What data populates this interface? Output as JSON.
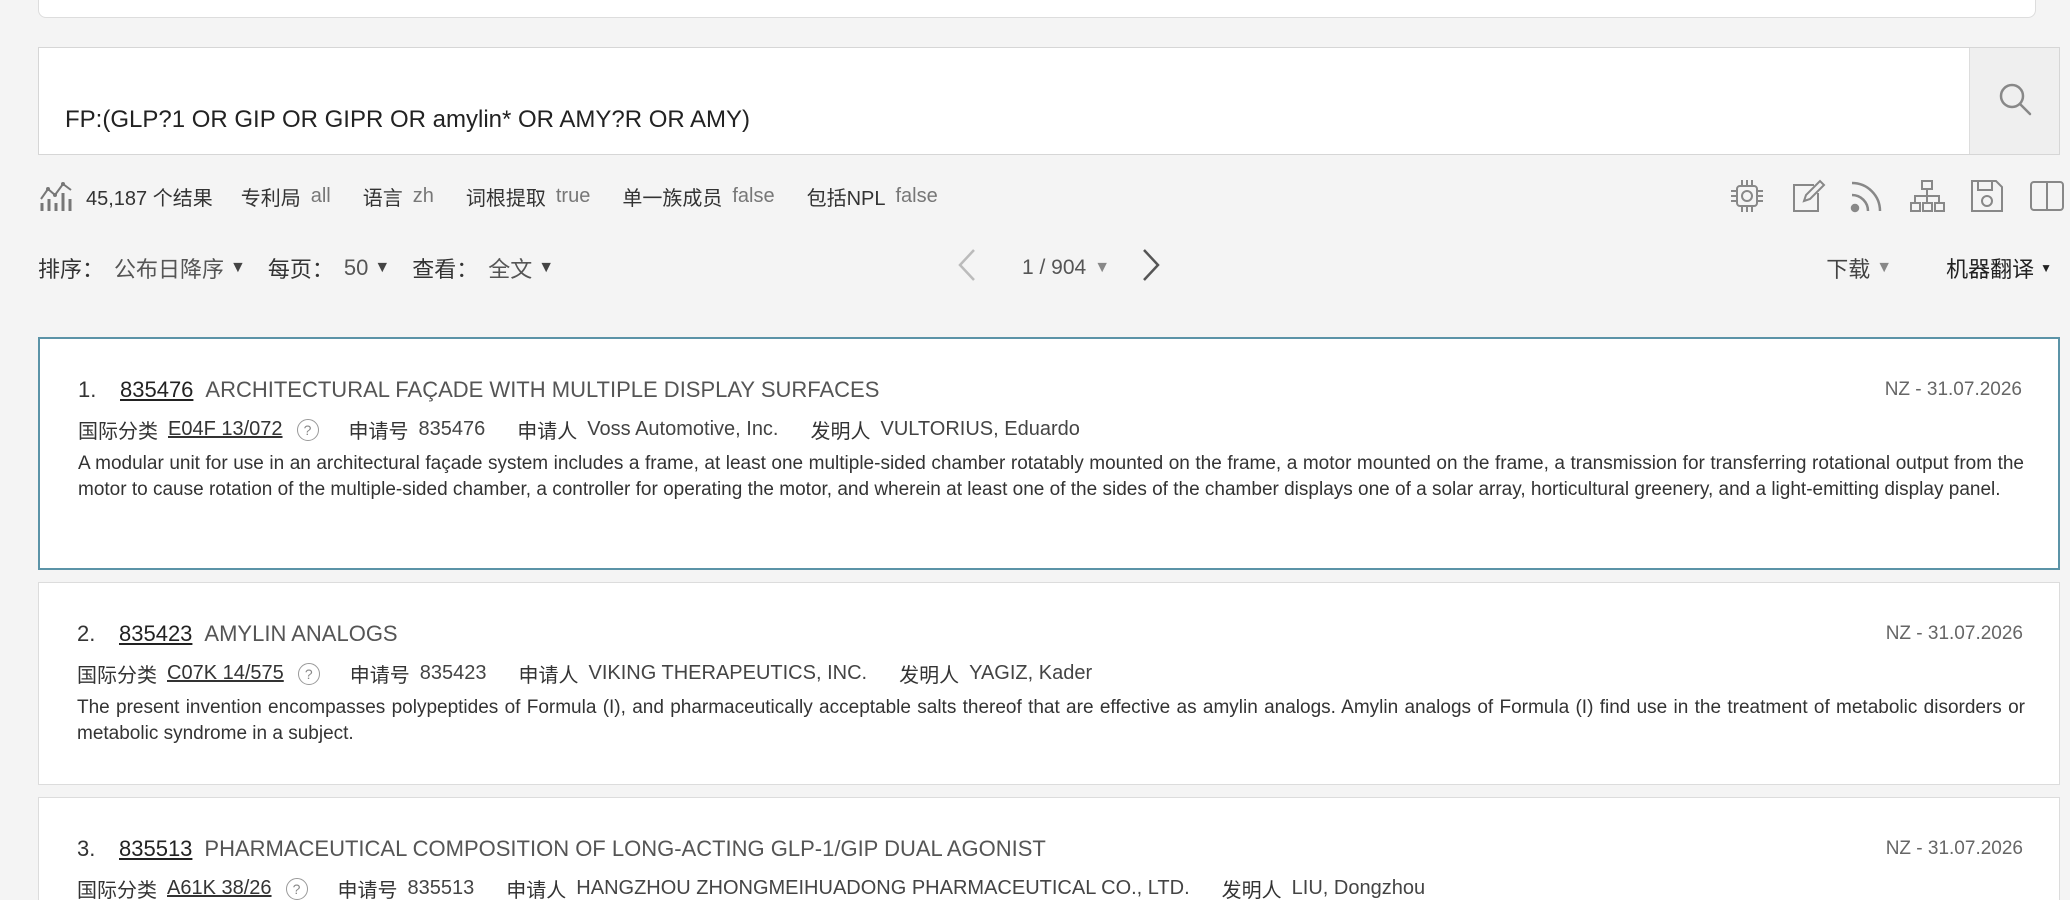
{
  "search": {
    "query": "FP:(GLP?1 OR GIP OR GIPR OR amylin* OR AMY?R OR AMY)"
  },
  "stats": {
    "result_count": "45,187 个结果",
    "filters": [
      {
        "label": "专利局",
        "value": "all"
      },
      {
        "label": "语言",
        "value": "zh"
      },
      {
        "label": "词根提取",
        "value": "true"
      },
      {
        "label": "单一族成员",
        "value": "false"
      },
      {
        "label": "包括NPL",
        "value": "false"
      }
    ]
  },
  "toolbar_icons": [
    "chip-icon",
    "edit-icon",
    "rss-icon",
    "hierarchy-icon",
    "save-icon",
    "split-view-icon"
  ],
  "controls": {
    "sort_label": "排序：",
    "sort_value": "公布日降序",
    "per_page_label": "每页：",
    "per_page_value": "50",
    "view_label": "查看：",
    "view_value": "全文",
    "page": "1 / 904",
    "download": "下载",
    "translate": "机器翻译"
  },
  "labels": {
    "ipc": "国际分类",
    "app_no": "申请号",
    "applicant": "申请人",
    "inventor": "发明人"
  },
  "results": [
    {
      "num": "1.",
      "pn": "835476",
      "title": "ARCHITECTURAL FAÇADE WITH MULTIPLE DISPLAY SURFACES",
      "date": "NZ - 31.07.2026",
      "ipc": "E04F 13/072",
      "app_no": "835476",
      "applicant": "Voss Automotive, Inc.",
      "inventor": "VULTORIUS, Eduardo",
      "abstract": "A modular unit for use in an architectural façade system includes a frame, at least one multiple-sided chamber rotatably mounted on the frame, a motor mounted on the frame, a transmission for transferring rotational output from the motor to cause rotation of the multiple-sided chamber, a controller for operating the motor, and wherein at least one of the sides of the chamber displays one of a solar array, horticultural greenery, and a light-emitting display panel."
    },
    {
      "num": "2.",
      "pn": "835423",
      "title": "AMYLIN ANALOGS",
      "date": "NZ - 31.07.2026",
      "ipc": "C07K 14/575",
      "app_no": "835423",
      "applicant": "VIKING THERAPEUTICS, INC.",
      "inventor": "YAGIZ, Kader",
      "abstract": "The present invention encompasses polypeptides of Formula (I), and pharmaceutically acceptable salts thereof that are effective as amylin analogs. Amylin analogs of Formula (I) find use in the treatment of metabolic disorders or metabolic syndrome in a subject."
    },
    {
      "num": "3.",
      "pn": "835513",
      "title": "PHARMACEUTICAL COMPOSITION OF LONG-ACTING GLP-1/GIP DUAL AGONIST",
      "date": "NZ - 31.07.2026",
      "ipc": "A61K 38/26",
      "app_no": "835513",
      "applicant": "HANGZHOU ZHONGMEIHUADONG PHARMACEUTICAL CO., LTD.",
      "inventor": "LIU, Dongzhou",
      "abstract": ""
    }
  ]
}
